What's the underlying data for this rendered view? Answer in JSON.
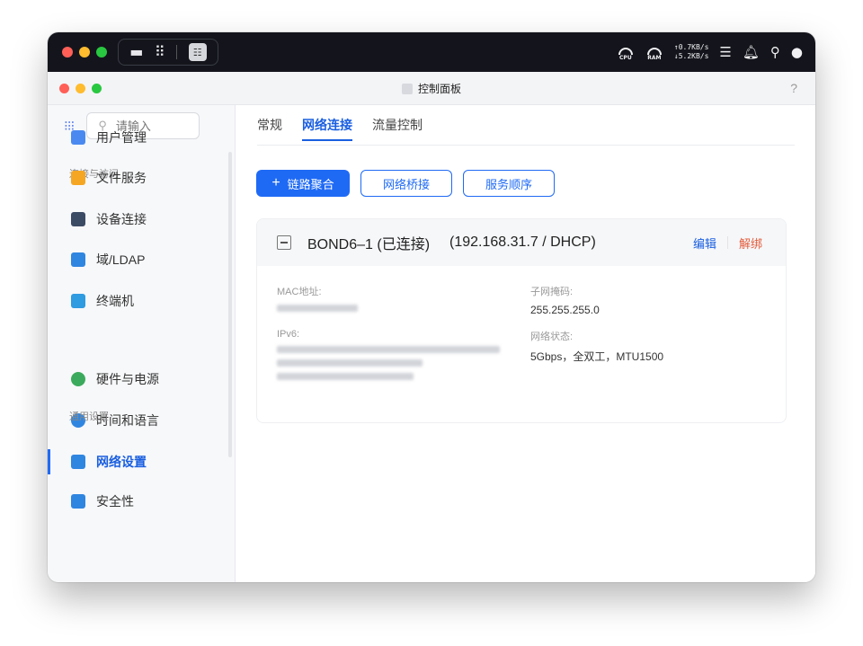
{
  "sysbar": {
    "dock_app_icon": "control-panel-icon",
    "cpu_label": "CPU",
    "ram_label": "RAM",
    "upload_speed": "↑0.7KB/s",
    "download_speed": "↓5.2KB/s"
  },
  "window": {
    "title": "控制面板",
    "help": "?"
  },
  "sidebar": {
    "search_placeholder": "请输入",
    "sections": [
      "连接与访问",
      "通用设置"
    ],
    "items": [
      {
        "label": "用户管理",
        "color": "#4a8af0"
      },
      {
        "label": "文件服务",
        "color": "#f5a623"
      },
      {
        "label": "设备连接",
        "color": "#3c4b64"
      },
      {
        "label": "域/LDAP",
        "color": "#2f86e0"
      },
      {
        "label": "终端机",
        "color": "#2f9be0"
      },
      {
        "label": "硬件与电源",
        "color": "#3caa5c"
      },
      {
        "label": "时间和语言",
        "color": "#2f86e0"
      },
      {
        "label": "网络设置",
        "color": "#2f86e0"
      },
      {
        "label": "安全性",
        "color": "#2f86e0"
      }
    ],
    "active_index": 7
  },
  "tabs": [
    "常规",
    "网络连接",
    "流量控制"
  ],
  "active_tab": 1,
  "buttons": {
    "link_aggregation": "链路聚合",
    "network_bridge": "网络桥接",
    "service_order": "服务顺序"
  },
  "bond": {
    "name": "BOND6–1 (已连接)",
    "address": "(192.168.31.7 / DHCP)",
    "edit": "编辑",
    "unbind": "解绑",
    "mac_label": "MAC地址:",
    "subnet_label": "子网掩码:",
    "subnet_value": "255.255.255.0",
    "ipv6_label": "IPv6:",
    "status_label": "网络状态:",
    "status_value": "5Gbps，全双工，MTU1500"
  },
  "colors": {
    "accent": "#1f6af5",
    "danger": "#e25c3c"
  }
}
